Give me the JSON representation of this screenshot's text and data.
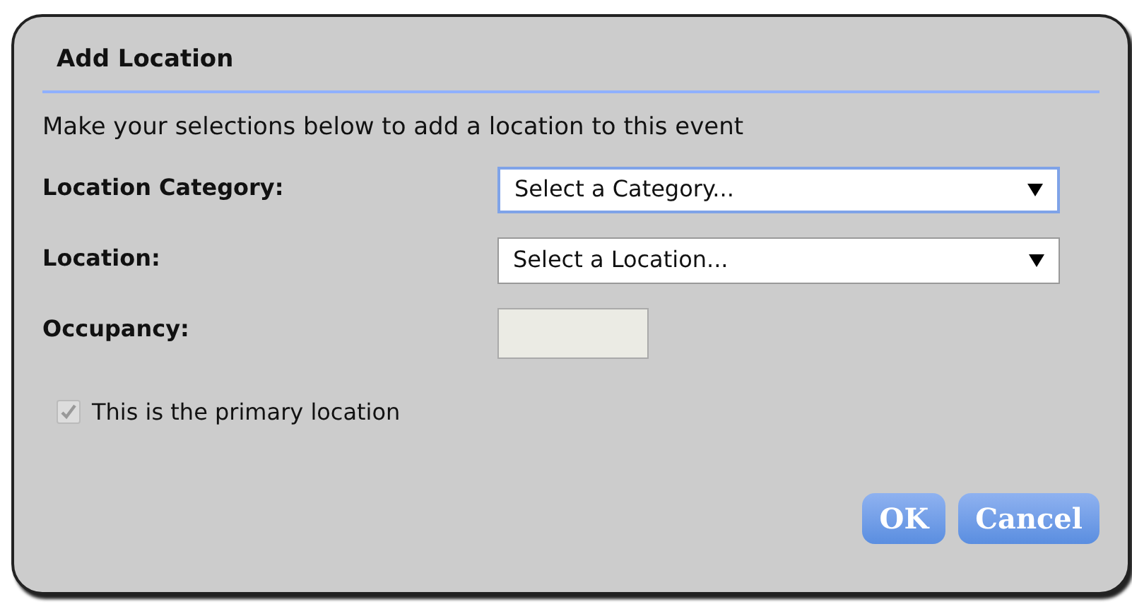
{
  "dialog": {
    "title": "Add Location",
    "intro": "Make your selections below to add a location to this event"
  },
  "fields": [
    {
      "label": "Location Category:",
      "kind": "select",
      "value": "Select a Category...",
      "focused": true
    },
    {
      "label": "Location:",
      "kind": "select",
      "value": "Select a Location...",
      "focused": false
    },
    {
      "label": "Occupancy:",
      "kind": "text",
      "disabled": true
    }
  ],
  "checkbox": {
    "label": "This is the primary location",
    "checked": true,
    "disabled": true
  },
  "buttons": [
    "OK",
    "Cancel"
  ]
}
